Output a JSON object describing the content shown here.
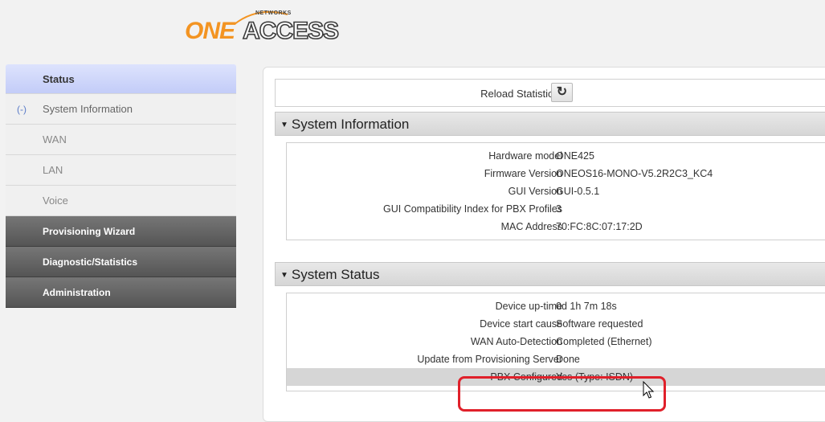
{
  "logo": {
    "part1": "ONE",
    "part2": "ACCESS",
    "sup": "NETWORKS"
  },
  "sidebar": {
    "items": [
      {
        "label": "Status"
      },
      {
        "label": "System Information",
        "marker": "(-)"
      },
      {
        "label": "WAN"
      },
      {
        "label": "LAN"
      },
      {
        "label": "Voice"
      },
      {
        "label": "Provisioning Wizard"
      },
      {
        "label": "Diagnostic/Statistics"
      },
      {
        "label": "Administration"
      }
    ]
  },
  "main": {
    "reload_label": "Reload Statistics",
    "reload_icon": "reload-icon",
    "system_information": {
      "title": "System Information",
      "rows": [
        {
          "key": "Hardware model",
          "value": "ONE425"
        },
        {
          "key": "Firmware Version",
          "value": "ONEOS16-MONO-V5.2R2C3_KC4"
        },
        {
          "key": "GUI Version",
          "value": "GUI-0.5.1"
        },
        {
          "key": "GUI Compatibility Index for PBX Profiles",
          "value": "3"
        },
        {
          "key": "MAC Address",
          "value": "70:FC:8C:07:17:2D"
        }
      ]
    },
    "system_status": {
      "title": "System Status",
      "rows": [
        {
          "key": "Device up-time",
          "value": "0d 1h 7m 18s"
        },
        {
          "key": "Device start cause",
          "value": "Software requested"
        },
        {
          "key": "WAN Auto-Detection",
          "value": "Completed (Ethernet)"
        },
        {
          "key": "Update from Provisioning Server",
          "value": "Done"
        },
        {
          "key": "PBX Configured",
          "value": "Yes (Type: ISDN)"
        }
      ]
    }
  },
  "colors": {
    "highlight": "#e0202a",
    "brand_orange": "#f39422",
    "nav_active": "#c3ccf8",
    "nav_dark": "#555555"
  }
}
